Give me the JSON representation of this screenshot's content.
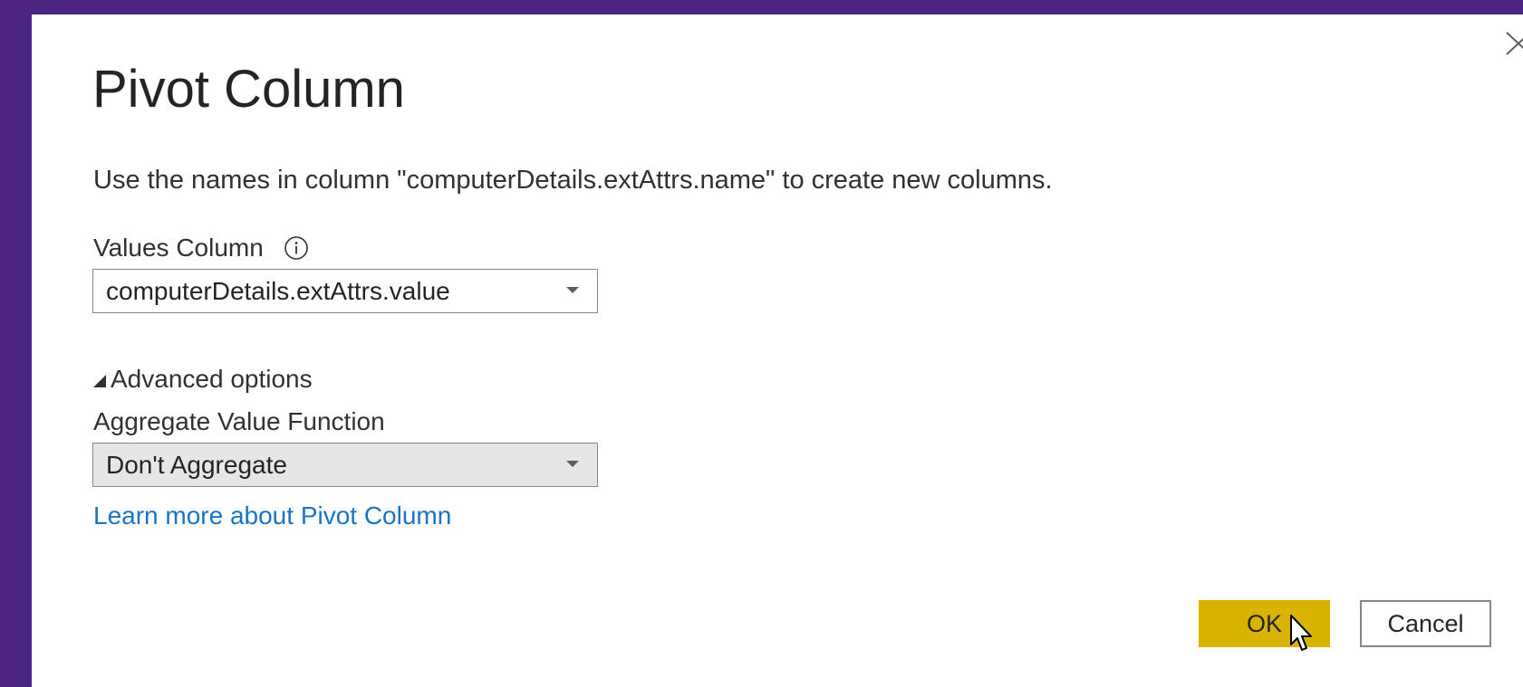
{
  "dialog": {
    "title": "Pivot Column",
    "description": "Use the names in column \"computerDetails.extAttrs.name\" to create new columns.",
    "values_column": {
      "label": "Values Column",
      "selected": "computerDetails.extAttrs.value"
    },
    "advanced_options_label": "Advanced options",
    "aggregate": {
      "label": "Aggregate Value Function",
      "selected": "Don't Aggregate"
    },
    "learn_more_link": "Learn more about Pivot Column",
    "buttons": {
      "ok": "OK",
      "cancel": "Cancel"
    }
  },
  "colors": {
    "background": "#4b2581",
    "ok_button": "#d8b400",
    "link": "#1a74c6",
    "aggregate_select_bg": "#e6e6e6"
  },
  "icons": {
    "close": "close-icon",
    "info": "info-icon",
    "dropdown": "chevron-down-icon",
    "expand": "triangle-expanded-icon",
    "cursor": "mouse-pointer-icon"
  }
}
